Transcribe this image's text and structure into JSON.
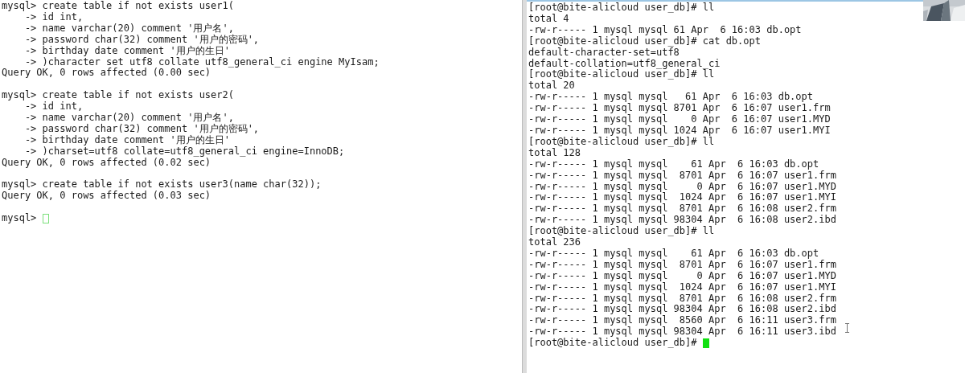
{
  "panes": [
    {
      "blocks": [
        [
          "mysql> create table if not exists user1(",
          "    -> id int,",
          "    -> name varchar(20) comment '用户名',",
          "    -> password char(32) comment '用户的密码',",
          "    -> birthday date comment '用户的生日'",
          "    -> )character set utf8 collate utf8_general_ci engine MyIsam;",
          "Query OK, 0 rows affected (0.00 sec)"
        ],
        [
          "mysql> create table if not exists user2(",
          "    -> id int,",
          "    -> name varchar(20) comment '用户名',",
          "    -> password char(32) comment '用户的密码',",
          "    -> birthday date comment '用户的生日'",
          "    -> )charset=utf8 collate=utf8_general_ci engine=InnoDB;",
          "Query OK, 0 rows affected (0.02 sec)"
        ],
        [
          "mysql> create table if not exists user3(name char(32));",
          "Query OK, 0 rows affected (0.03 sec)"
        ],
        [
          "mysql> "
        ]
      ],
      "cursor": {
        "focused": false
      }
    },
    {
      "blocks": [
        [
          "[root@bite-alicloud user_db]# ll",
          "total 4",
          "-rw-r----- 1 mysql mysql 61 Apr  6 16:03 db.opt",
          "[root@bite-alicloud user_db]# cat db.opt",
          "default-character-set=utf8",
          "default-collation=utf8_general_ci",
          "[root@bite-alicloud user_db]# ll",
          "total 20",
          "-rw-r----- 1 mysql mysql   61 Apr  6 16:03 db.opt",
          "-rw-r----- 1 mysql mysql 8701 Apr  6 16:07 user1.frm",
          "-rw-r----- 1 mysql mysql    0 Apr  6 16:07 user1.MYD",
          "-rw-r----- 1 mysql mysql 1024 Apr  6 16:07 user1.MYI",
          "[root@bite-alicloud user_db]# ll",
          "total 128",
          "-rw-r----- 1 mysql mysql    61 Apr  6 16:03 db.opt",
          "-rw-r----- 1 mysql mysql  8701 Apr  6 16:07 user1.frm",
          "-rw-r----- 1 mysql mysql     0 Apr  6 16:07 user1.MYD",
          "-rw-r----- 1 mysql mysql  1024 Apr  6 16:07 user1.MYI",
          "-rw-r----- 1 mysql mysql  8701 Apr  6 16:08 user2.frm",
          "-rw-r----- 1 mysql mysql 98304 Apr  6 16:08 user2.ibd",
          "[root@bite-alicloud user_db]# ll",
          "total 236",
          "-rw-r----- 1 mysql mysql    61 Apr  6 16:03 db.opt",
          "-rw-r----- 1 mysql mysql  8701 Apr  6 16:07 user1.frm",
          "-rw-r----- 1 mysql mysql     0 Apr  6 16:07 user1.MYD",
          "-rw-r----- 1 mysql mysql  1024 Apr  6 16:07 user1.MYI",
          "-rw-r----- 1 mysql mysql  8701 Apr  6 16:08 user2.frm",
          "-rw-r----- 1 mysql mysql 98304 Apr  6 16:08 user2.ibd",
          "-rw-r----- 1 mysql mysql  8560 Apr  6 16:11 user3.frm",
          "-rw-r----- 1 mysql mysql 98304 Apr  6 16:11 user3.ibd",
          "[root@bite-alicloud user_db]# "
        ]
      ],
      "cursor": {
        "focused": true
      }
    }
  ]
}
